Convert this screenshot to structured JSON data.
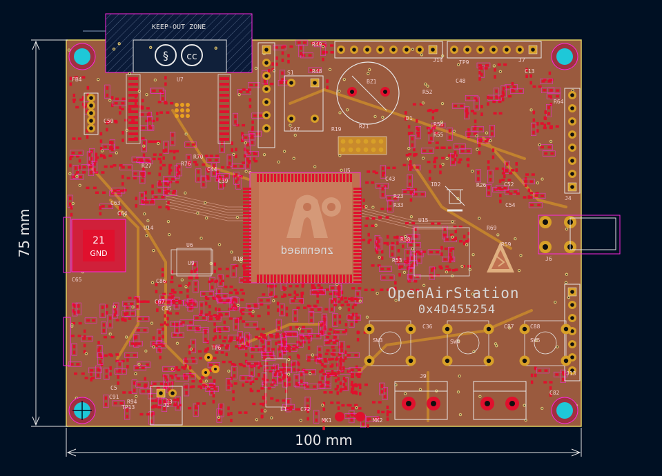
{
  "colors": {
    "background": "#001023",
    "board": "#9a5a3e",
    "copper": "#e0102d",
    "trace_inner": "#c98a2c",
    "silkscreen": "#e8e8e8",
    "courtyard": "#ff26e2",
    "hole": "#1ec8d8",
    "dimension": "#e6e6e6"
  },
  "dimensions": {
    "height_label": "75 mm",
    "width_label": "100 mm"
  },
  "silkscreen": {
    "brand": "OpenAirStation",
    "hex_code": "0x4D455254",
    "keepout": "KEEP-OUT ZONE",
    "gnd_pad_number": "21",
    "gnd_pad_label": "GND",
    "mirrored_text": "znenmaed"
  },
  "refs": [
    "FB4",
    "U7",
    "S1",
    "R49",
    "R48",
    "BZ1",
    "R52",
    "J14",
    "TP9",
    "J7",
    "C13",
    "R64",
    "C47",
    "D1",
    "C48",
    "R56",
    "R55",
    "R19",
    "R21",
    "U5",
    "R27",
    "R76",
    "C44",
    "R70",
    "C39",
    "R18",
    "C50",
    "C63",
    "C64",
    "U14",
    "U6",
    "U9",
    "U15",
    "ID2",
    "R26",
    "C54",
    "C52",
    "J4",
    "J6",
    "R69",
    "SW3",
    "SW4",
    "SW5",
    "C36",
    "C87",
    "C88",
    "J13",
    "C82",
    "J9",
    "MK1",
    "MK2",
    "TP6",
    "TP13",
    "J2",
    "C72",
    "L1",
    "C91",
    "R94",
    "C65",
    "C45",
    "C86",
    "C67",
    "R23",
    "R33",
    "C43",
    "R58",
    "R53",
    "R59",
    "J3",
    "C5"
  ],
  "icons": [
    "mounting-hole-icon",
    "buzzer-icon",
    "esd-warning-icon",
    "trash-bin-icon",
    "oshw-logo-icon",
    "cc-license-icon"
  ]
}
